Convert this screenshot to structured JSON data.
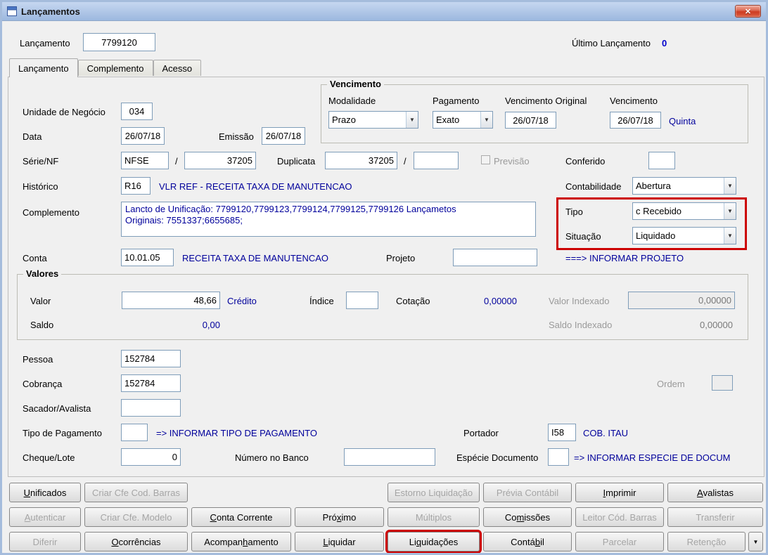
{
  "window": {
    "title": "Lançamentos"
  },
  "icons": {
    "close": "✕",
    "combo_arrow": "▼",
    "more_arrow": "▼"
  },
  "colors": {
    "link_text": "#00009B",
    "highlight": "#CC0000"
  },
  "header": {
    "lancamento_label": "Lançamento",
    "lancamento_value": "7799120",
    "ultimo_label": "Último Lançamento",
    "ultimo_value": "0"
  },
  "tabs": {
    "lancamento": "Lançamento",
    "complemento": "Complemento",
    "acesso": "Acesso"
  },
  "form": {
    "unidade_label": "Unidade de Negócio",
    "unidade_value": "034",
    "data_label": "Data",
    "data_value": "26/07/18",
    "emissao_label": "Emissão",
    "emissao_value": "26/07/18",
    "vencimento": {
      "title": "Vencimento",
      "modalidade_label": "Modalidade",
      "modalidade_value": "Prazo",
      "pagamento_label": "Pagamento",
      "pagamento_value": "Exato",
      "vencimento_original_label": "Vencimento Original",
      "vencimento_original_value": "26/07/18",
      "vencimento_label": "Vencimento",
      "vencimento_value": "26/07/18",
      "dia_semana": "Quinta"
    },
    "serie_label": "Série/NF",
    "serie_value": "NFSE",
    "sep": "/",
    "serie_numero": "37205",
    "duplicata_label": "Duplicata",
    "duplicata_value": "37205",
    "duplicata_compl": "",
    "previsao_label": "Previsão",
    "conferido_label": "Conferido",
    "conferido_value": "",
    "historico_label": "Histórico",
    "historico_value": "R16",
    "historico_desc": "VLR REF - RECEITA TAXA DE MANUTENCAO",
    "contabilidade_label": "Contabilidade",
    "contabilidade_value": "Abertura",
    "complemento_label": "Complemento",
    "complemento_line1": "Lancto de Unificação: 7799120,7799123,7799124,7799125,7799126 Lançametos",
    "complemento_line2": "Originais: 7551337;6655685;",
    "tipo_label": "Tipo",
    "tipo_value": "c Recebido",
    "situacao_label": "Situação",
    "situacao_value": "Liquidado",
    "conta_label": "Conta",
    "conta_value": "10.01.05",
    "conta_desc": "RECEITA TAXA DE MANUTENCAO",
    "projeto_label": "Projeto",
    "projeto_value": "",
    "projeto_hint": "===> INFORMAR PROJETO",
    "valores": {
      "title": "Valores",
      "valor_label": "Valor",
      "valor_value": "48,66",
      "credito_label": "Crédito",
      "indice_label": "Índice",
      "indice_value": "",
      "cotacao_label": "Cotação",
      "cotacao_value": "0,00000",
      "valor_indexado_label": "Valor Indexado",
      "valor_indexado_value": "0,00000",
      "saldo_label": "Saldo",
      "saldo_value": "0,00",
      "saldo_indexado_label": "Saldo Indexado",
      "saldo_indexado_value": "0,00000"
    },
    "pessoa_label": "Pessoa",
    "pessoa_value": "152784",
    "cobranca_label": "Cobrança",
    "cobranca_value": "152784",
    "ordem_label": "Ordem",
    "ordem_value": "",
    "sacador_label": "Sacador/Avalista",
    "sacador_value": "",
    "tipo_pagamento_label": "Tipo de Pagamento",
    "tipo_pagamento_value": "",
    "tipo_pagamento_hint": "=> INFORMAR TIPO DE PAGAMENTO",
    "portador_label": "Portador",
    "portador_value": "I58",
    "portador_desc": "COB. ITAU",
    "cheque_label": "Cheque/Lote",
    "cheque_value": "0",
    "numero_banco_label": "Número no Banco",
    "numero_banco_value": "",
    "especie_label": "Espécie Documento",
    "especie_value": "",
    "especie_hint": "=> INFORMAR ESPECIE DE DOCUM"
  },
  "buttons": {
    "unificados": "&Unificados",
    "criar_cfe_cod_barras": "Criar Cfe Cod. Barras",
    "estorno_liquidacao": "Estorno Liquidação",
    "previa_contabil": "Prévia Contábil",
    "imprimir": "&Imprimir",
    "avalistas": "&Avalistas",
    "autenticar": "&Autenticar",
    "criar_cfe_modelo": "Criar Cfe. Modelo",
    "conta_corrente": "&Conta Corrente",
    "proximo": "Pró&ximo",
    "multiplos": "Múltiplos",
    "comissoes": "Co&missões",
    "leitor_cod_barras": "Leitor Cód. Barras",
    "transferir": "Transferir",
    "diferir": "Diferir",
    "ocorrencias": "&Ocorrências",
    "acompanhamento": "Acompan&hamento",
    "liquidar": "&Liquidar",
    "liquidacoes": "Li&quidações",
    "contabil": "Contá&bil",
    "parcelar": "Parcelar",
    "retencao": "Retenção"
  }
}
